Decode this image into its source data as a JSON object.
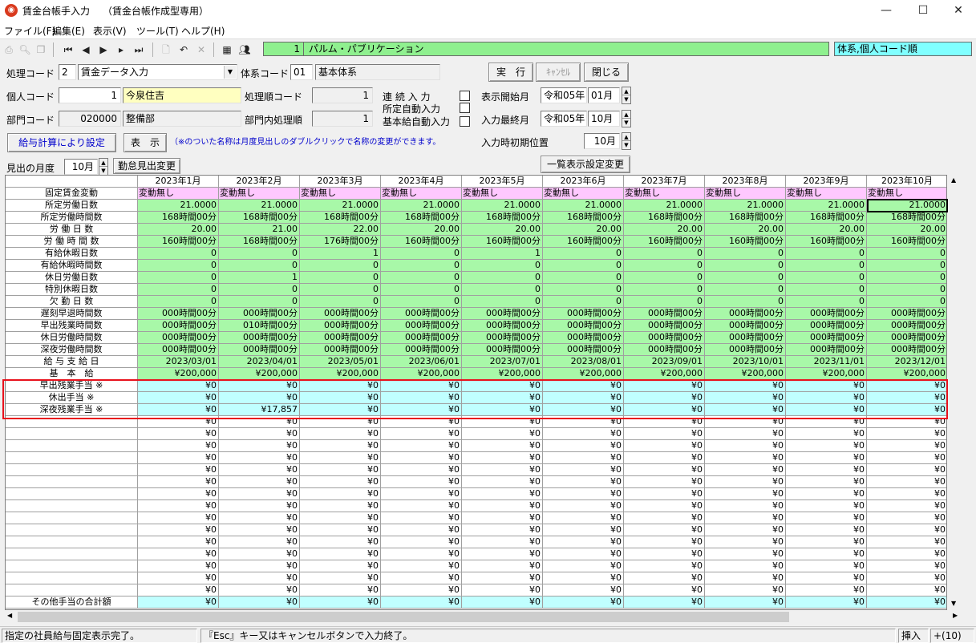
{
  "window": {
    "title": "賃金台帳手入力",
    "subtitle": "（賃金台帳作成型専用）",
    "minimize": "—",
    "maximize": "☐",
    "close": "✕"
  },
  "menu": [
    "ファイル(F)",
    "編集(E)",
    "表示(V)",
    "ツール(T)",
    "ヘルプ(H)"
  ],
  "toolbar": {
    "company_no": "1",
    "company_name": "パルム・パブリケーション",
    "sort_mode": "体系,個人コード順"
  },
  "form": {
    "proc_code_label": "処理コード",
    "proc_code": "2",
    "proc_name": "賃金データ入力",
    "system_code_label": "体系コード",
    "system_code": "01",
    "system_name": "基本体系",
    "run_btn": "実　行",
    "cancel_btn": "ｷｬﾝｾﾙ",
    "close_btn": "閉じる",
    "person_code_label": "個人コード",
    "person_code": "1",
    "person_name": "今泉住吉",
    "order_code_label": "処理順コード",
    "order_code": "1",
    "continuous_label": "連 続 入 力",
    "auto_fixed_label": "所定自動入力",
    "auto_base_label": "基本給自動入力",
    "display_start_label": "表示開始月",
    "display_start_era": "令和05",
    "year_suffix": "年",
    "display_start_month": "01",
    "month_suffix": "月",
    "dept_code_label": "部門コード",
    "dept_code": "020000",
    "dept_name": "整備部",
    "dept_order_label": "部門内処理順",
    "dept_order": "1",
    "input_last_label": "入力最終月",
    "input_last_era": "令和05",
    "input_last_month": "10",
    "calc_btn": "給与計算により設定",
    "show_btn": "表　示",
    "note": "（※のついた名称は月度見出しのダブルクリックで名称の変更ができます。",
    "initial_pos_label": "入力時初期位置",
    "initial_pos": "10月",
    "midashi_label": "見出の月度",
    "midashi_month": "10月",
    "kintai_btn": "勤怠見出変更",
    "list_btn": "一覧表示設定変更"
  },
  "grid": {
    "months": [
      "2023年1月",
      "2023年2月",
      "2023年3月",
      "2023年4月",
      "2023年5月",
      "2023年6月",
      "2023年7月",
      "2023年8月",
      "2023年9月",
      "2023年10月"
    ],
    "rows": [
      {
        "label": "固定賃金変動",
        "color": "pink",
        "align": "left",
        "values": [
          "変動無し",
          "変動無し",
          "変動無し",
          "変動無し",
          "変動無し",
          "変動無し",
          "変動無し",
          "変動無し",
          "変動無し",
          "変動無し"
        ]
      },
      {
        "label": "所定労働日数",
        "color": "green",
        "values": [
          "21.0000",
          "21.0000",
          "21.0000",
          "21.0000",
          "21.0000",
          "21.0000",
          "21.0000",
          "21.0000",
          "21.0000",
          "21.0000"
        ]
      },
      {
        "label": "所定労働時間数",
        "color": "green",
        "values": [
          "168時間00分",
          "168時間00分",
          "168時間00分",
          "168時間00分",
          "168時間00分",
          "168時間00分",
          "168時間00分",
          "168時間00分",
          "168時間00分",
          "168時間00分"
        ]
      },
      {
        "label": "労 働 日 数",
        "color": "green",
        "values": [
          "20.00",
          "21.00",
          "22.00",
          "20.00",
          "20.00",
          "20.00",
          "20.00",
          "20.00",
          "20.00",
          "20.00"
        ]
      },
      {
        "label": "労 働 時 間 数",
        "color": "green",
        "values": [
          "160時間00分",
          "168時間00分",
          "176時間00分",
          "160時間00分",
          "160時間00分",
          "160時間00分",
          "160時間00分",
          "160時間00分",
          "160時間00分",
          "160時間00分"
        ]
      },
      {
        "label": "有給休暇日数",
        "color": "green",
        "values": [
          "0",
          "0",
          "1",
          "0",
          "1",
          "0",
          "0",
          "0",
          "0",
          "0"
        ]
      },
      {
        "label": "有給休暇時間数",
        "color": "green",
        "values": [
          "0",
          "0",
          "0",
          "0",
          "0",
          "0",
          "0",
          "0",
          "0",
          "0"
        ]
      },
      {
        "label": "休日労働日数",
        "color": "green",
        "values": [
          "0",
          "1",
          "0",
          "0",
          "0",
          "0",
          "0",
          "0",
          "0",
          "0"
        ]
      },
      {
        "label": "特別休暇日数",
        "color": "green",
        "values": [
          "0",
          "0",
          "0",
          "0",
          "0",
          "0",
          "0",
          "0",
          "0",
          "0"
        ]
      },
      {
        "label": "欠 勤 日 数",
        "color": "green",
        "values": [
          "0",
          "0",
          "0",
          "0",
          "0",
          "0",
          "0",
          "0",
          "0",
          "0"
        ]
      },
      {
        "label": "遅刻早退時間数",
        "color": "green",
        "values": [
          "000時間00分",
          "000時間00分",
          "000時間00分",
          "000時間00分",
          "000時間00分",
          "000時間00分",
          "000時間00分",
          "000時間00分",
          "000時間00分",
          "000時間00分"
        ]
      },
      {
        "label": "早出残業時間数",
        "color": "green",
        "values": [
          "000時間00分",
          "010時間00分",
          "000時間00分",
          "000時間00分",
          "000時間00分",
          "000時間00分",
          "000時間00分",
          "000時間00分",
          "000時間00分",
          "000時間00分"
        ]
      },
      {
        "label": "休日労働時間数",
        "color": "green",
        "values": [
          "000時間00分",
          "000時間00分",
          "000時間00分",
          "000時間00分",
          "000時間00分",
          "000時間00分",
          "000時間00分",
          "000時間00分",
          "000時間00分",
          "000時間00分"
        ]
      },
      {
        "label": "深夜労働時間数",
        "color": "green",
        "values": [
          "000時間00分",
          "000時間00分",
          "000時間00分",
          "000時間00分",
          "000時間00分",
          "000時間00分",
          "000時間00分",
          "000時間00分",
          "000時間00分",
          "000時間00分"
        ]
      },
      {
        "label": "給 与 支 給 日",
        "color": "green",
        "values": [
          "2023/03/01",
          "2023/04/01",
          "2023/05/01",
          "2023/06/01",
          "2023/07/01",
          "2023/08/01",
          "2023/09/01",
          "2023/10/01",
          "2023/11/01",
          "2023/12/01"
        ]
      },
      {
        "label": "基　本　給",
        "color": "green",
        "values": [
          "¥200,000",
          "¥200,000",
          "¥200,000",
          "¥200,000",
          "¥200,000",
          "¥200,000",
          "¥200,000",
          "¥200,000",
          "¥200,000",
          "¥200,000"
        ]
      },
      {
        "label": "早出残業手当 ※",
        "color": "cyan",
        "values": [
          "¥0",
          "¥0",
          "¥0",
          "¥0",
          "¥0",
          "¥0",
          "¥0",
          "¥0",
          "¥0",
          "¥0"
        ]
      },
      {
        "label": "休出手当 ※",
        "color": "cyan",
        "values": [
          "¥0",
          "¥0",
          "¥0",
          "¥0",
          "¥0",
          "¥0",
          "¥0",
          "¥0",
          "¥0",
          "¥0"
        ]
      },
      {
        "label": "深夜残業手当 ※",
        "color": "cyan",
        "values": [
          "¥0",
          "¥17,857",
          "¥0",
          "¥0",
          "¥0",
          "¥0",
          "¥0",
          "¥0",
          "¥0",
          "¥0"
        ]
      },
      {
        "label": "",
        "color": "white",
        "values": [
          "¥0",
          "¥0",
          "¥0",
          "¥0",
          "¥0",
          "¥0",
          "¥0",
          "¥0",
          "¥0",
          "¥0"
        ]
      },
      {
        "label": "",
        "color": "white",
        "values": [
          "¥0",
          "¥0",
          "¥0",
          "¥0",
          "¥0",
          "¥0",
          "¥0",
          "¥0",
          "¥0",
          "¥0"
        ]
      },
      {
        "label": "",
        "color": "white",
        "values": [
          "¥0",
          "¥0",
          "¥0",
          "¥0",
          "¥0",
          "¥0",
          "¥0",
          "¥0",
          "¥0",
          "¥0"
        ]
      },
      {
        "label": "",
        "color": "white",
        "values": [
          "¥0",
          "¥0",
          "¥0",
          "¥0",
          "¥0",
          "¥0",
          "¥0",
          "¥0",
          "¥0",
          "¥0"
        ]
      },
      {
        "label": "",
        "color": "white",
        "values": [
          "¥0",
          "¥0",
          "¥0",
          "¥0",
          "¥0",
          "¥0",
          "¥0",
          "¥0",
          "¥0",
          "¥0"
        ]
      },
      {
        "label": "",
        "color": "white",
        "values": [
          "¥0",
          "¥0",
          "¥0",
          "¥0",
          "¥0",
          "¥0",
          "¥0",
          "¥0",
          "¥0",
          "¥0"
        ]
      },
      {
        "label": "",
        "color": "white",
        "values": [
          "¥0",
          "¥0",
          "¥0",
          "¥0",
          "¥0",
          "¥0",
          "¥0",
          "¥0",
          "¥0",
          "¥0"
        ]
      },
      {
        "label": "",
        "color": "white",
        "values": [
          "¥0",
          "¥0",
          "¥0",
          "¥0",
          "¥0",
          "¥0",
          "¥0",
          "¥0",
          "¥0",
          "¥0"
        ]
      },
      {
        "label": "",
        "color": "white",
        "values": [
          "¥0",
          "¥0",
          "¥0",
          "¥0",
          "¥0",
          "¥0",
          "¥0",
          "¥0",
          "¥0",
          "¥0"
        ]
      },
      {
        "label": "",
        "color": "white",
        "values": [
          "¥0",
          "¥0",
          "¥0",
          "¥0",
          "¥0",
          "¥0",
          "¥0",
          "¥0",
          "¥0",
          "¥0"
        ]
      },
      {
        "label": "",
        "color": "white",
        "values": [
          "¥0",
          "¥0",
          "¥0",
          "¥0",
          "¥0",
          "¥0",
          "¥0",
          "¥0",
          "¥0",
          "¥0"
        ]
      },
      {
        "label": "",
        "color": "white",
        "values": [
          "¥0",
          "¥0",
          "¥0",
          "¥0",
          "¥0",
          "¥0",
          "¥0",
          "¥0",
          "¥0",
          "¥0"
        ]
      },
      {
        "label": "",
        "color": "white",
        "values": [
          "¥0",
          "¥0",
          "¥0",
          "¥0",
          "¥0",
          "¥0",
          "¥0",
          "¥0",
          "¥0",
          "¥0"
        ]
      },
      {
        "label": "",
        "color": "white",
        "values": [
          "¥0",
          "¥0",
          "¥0",
          "¥0",
          "¥0",
          "¥0",
          "¥0",
          "¥0",
          "¥0",
          "¥0"
        ]
      },
      {
        "label": "",
        "color": "white",
        "values": [
          "¥0",
          "¥0",
          "¥0",
          "¥0",
          "¥0",
          "¥0",
          "¥0",
          "¥0",
          "¥0",
          "¥0"
        ]
      },
      {
        "label": "その他手当の合計額",
        "color": "cyan",
        "values": [
          "¥0",
          "¥0",
          "¥0",
          "¥0",
          "¥0",
          "¥0",
          "¥0",
          "¥0",
          "¥0",
          "¥0"
        ]
      }
    ]
  },
  "status": {
    "left": "指定の社員給与固定表示完了。",
    "middle": "『Esc』キー又はキャンセルボタンで入力終了。",
    "mode": "挿入",
    "count": "+(10)"
  },
  "colors": {
    "green": "#a8f8a8",
    "pink": "#ffc8ff",
    "cyan": "#c0ffff",
    "highlight": "#e8121d"
  }
}
